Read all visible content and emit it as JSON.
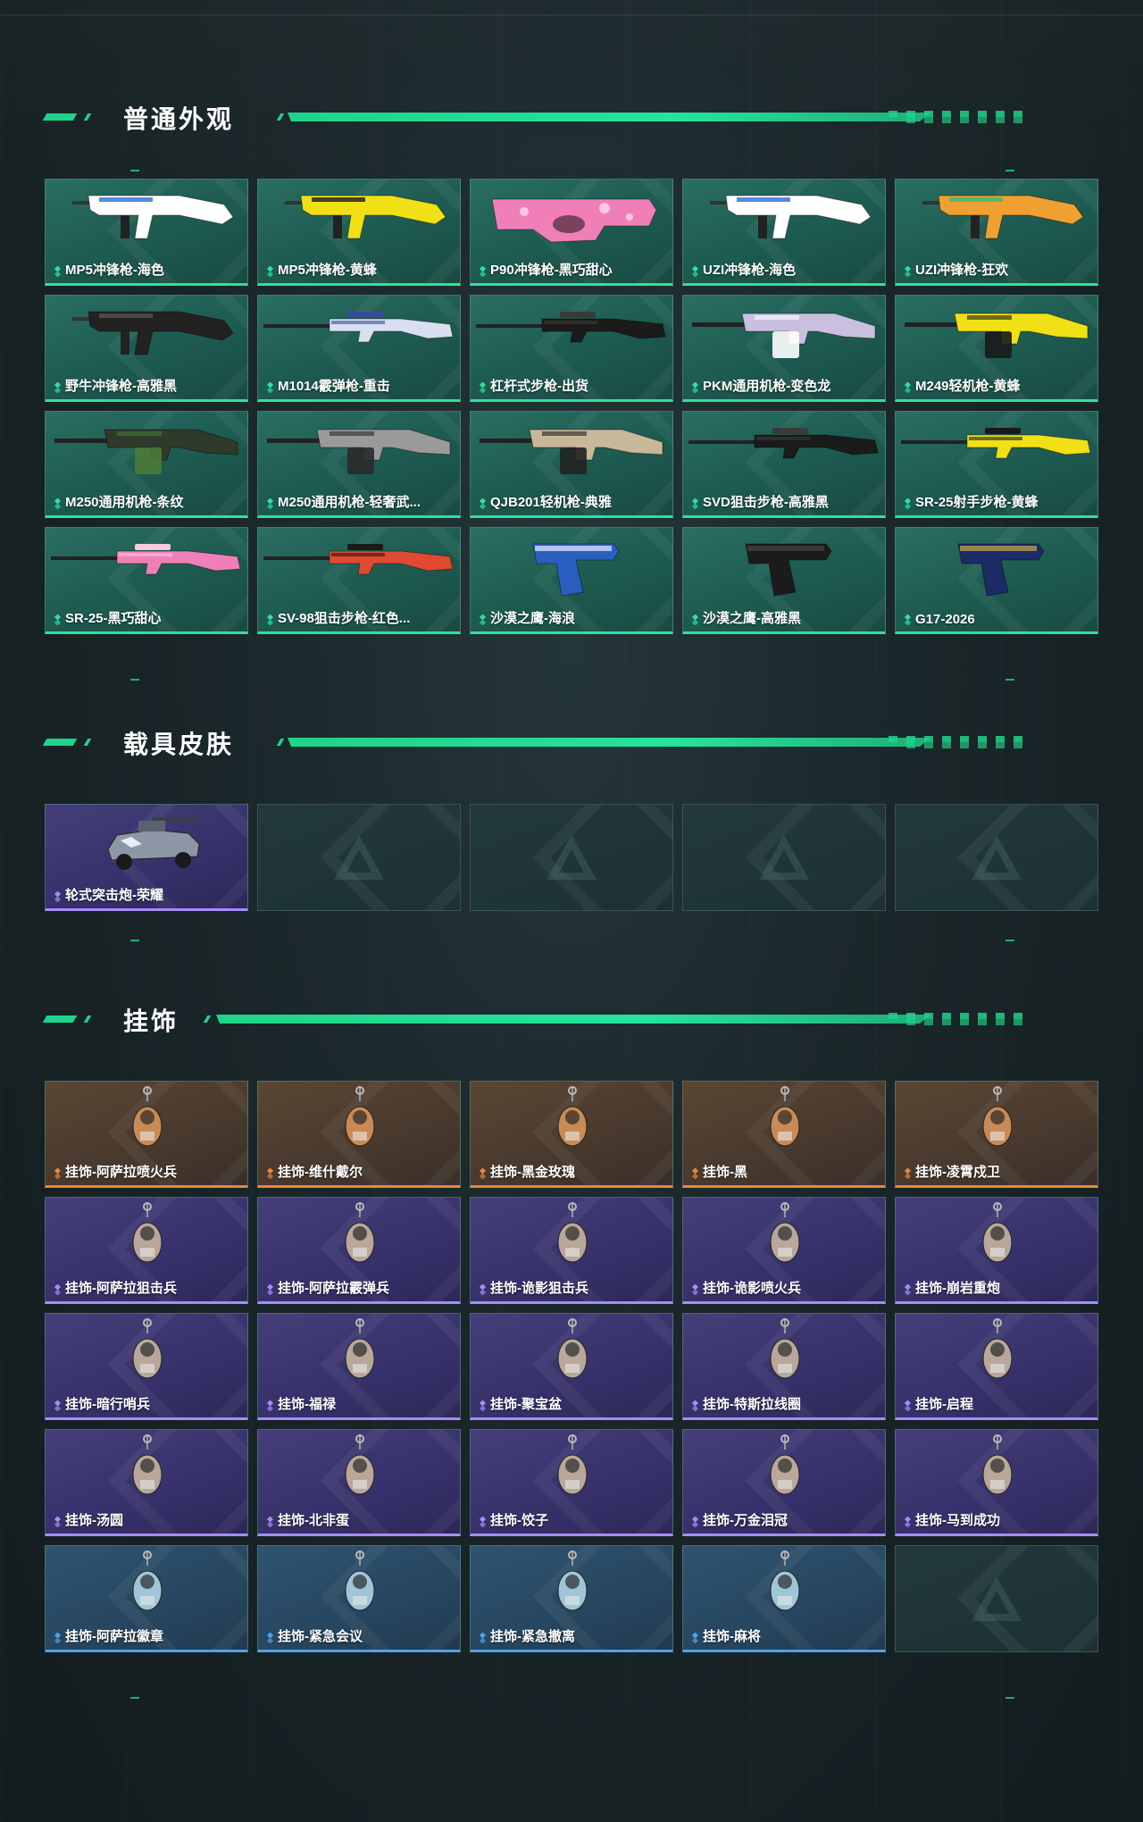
{
  "sections": {
    "weapons": {
      "title": "普通外观",
      "items": [
        {
          "label": "MP5冲锋枪-海色",
          "colors": [
            "#ffffff",
            "#2a6fd8"
          ],
          "icon": "smg-icon"
        },
        {
          "label": "MP5冲锋枪-黄蜂",
          "colors": [
            "#f2e017",
            "#1a1a1a"
          ],
          "icon": "smg-icon"
        },
        {
          "label": "P90冲锋枪-黑巧甜心",
          "colors": [
            "#f07fb8",
            "#f8c9e0"
          ],
          "icon": "p90-icon"
        },
        {
          "label": "UZI冲锋枪-海色",
          "colors": [
            "#ffffff",
            "#2a6fd8"
          ],
          "icon": "uzi-icon"
        },
        {
          "label": "UZI冲锋枪-狂欢",
          "colors": [
            "#f0a030",
            "#2ec07a"
          ],
          "icon": "uzi-icon"
        },
        {
          "label": "野牛冲锋枪-高雅黑",
          "colors": [
            "#222222",
            "#555555"
          ],
          "icon": "smg-icon"
        },
        {
          "label": "M1014霰弹枪-重击",
          "colors": [
            "#d8dff0",
            "#3a4a9a"
          ],
          "icon": "shotgun-icon"
        },
        {
          "label": "杠杆式步枪-出货",
          "colors": [
            "#1b1b1b",
            "#3a3a3a"
          ],
          "icon": "rifle-icon"
        },
        {
          "label": "PKM通用机枪-变色龙",
          "colors": [
            "#c9c0e0",
            "#ffffff"
          ],
          "icon": "mg-icon"
        },
        {
          "label": "M249轻机枪-黄蜂",
          "colors": [
            "#f2e017",
            "#1a1a1a"
          ],
          "icon": "mg-icon"
        },
        {
          "label": "M250通用机枪-条纹",
          "colors": [
            "#2f3a2a",
            "#4a7a3a"
          ],
          "icon": "mg-icon"
        },
        {
          "label": "M250通用机枪-轻奢武...",
          "colors": [
            "#9a9a9a",
            "#2a2a2a"
          ],
          "icon": "mg-icon"
        },
        {
          "label": "QJB201轻机枪-典雅",
          "colors": [
            "#c9b79a",
            "#222222"
          ],
          "icon": "mg-icon"
        },
        {
          "label": "SVD狙击步枪-高雅黑",
          "colors": [
            "#1b1b1b",
            "#3a3a3a"
          ],
          "icon": "sniper-icon"
        },
        {
          "label": "SR-25射手步枪-黄蜂",
          "colors": [
            "#f2e017",
            "#1a1a1a"
          ],
          "icon": "sniper-icon"
        },
        {
          "label": "SR-25-黑巧甜心",
          "colors": [
            "#f07fb8",
            "#f8c9e0"
          ],
          "icon": "rifle-icon"
        },
        {
          "label": "SV-98狙击步枪-红色...",
          "colors": [
            "#e04a30",
            "#1a1a1a"
          ],
          "icon": "sniper-icon"
        },
        {
          "label": "沙漠之鹰-海浪",
          "colors": [
            "#2a5fc0",
            "#e8f0ff"
          ],
          "icon": "pistol-icon"
        },
        {
          "label": "沙漠之鹰-高雅黑",
          "colors": [
            "#1b1b1b",
            "#444444"
          ],
          "icon": "pistol-icon"
        },
        {
          "label": "G17-2026",
          "colors": [
            "#1c2a66",
            "#c9a94a"
          ],
          "icon": "pistol-icon"
        }
      ]
    },
    "vehicles": {
      "title": "载具皮肤",
      "items": [
        {
          "label": "轮式突击炮-荣耀",
          "icon": "vehicle-icon"
        }
      ]
    },
    "charms": {
      "title": "挂饰",
      "items": [
        {
          "label": "挂饰-阿萨拉喷火兵",
          "rarity": "orange"
        },
        {
          "label": "挂饰-维什戴尔",
          "rarity": "orange"
        },
        {
          "label": "挂饰-黑金玫瑰",
          "rarity": "orange"
        },
        {
          "label": "挂饰-黑",
          "rarity": "orange"
        },
        {
          "label": "挂饰-凌霄戍卫",
          "rarity": "orange"
        },
        {
          "label": "挂饰-阿萨拉狙击兵",
          "rarity": "purple"
        },
        {
          "label": "挂饰-阿萨拉霰弹兵",
          "rarity": "purple"
        },
        {
          "label": "挂饰-诡影狙击兵",
          "rarity": "purple"
        },
        {
          "label": "挂饰-诡影喷火兵",
          "rarity": "purple"
        },
        {
          "label": "挂饰-崩岩重炮",
          "rarity": "purple"
        },
        {
          "label": "挂饰-暗行哨兵",
          "rarity": "purple"
        },
        {
          "label": "挂饰-福禄",
          "rarity": "purple"
        },
        {
          "label": "挂饰-聚宝盆",
          "rarity": "purple"
        },
        {
          "label": "挂饰-特斯拉线圈",
          "rarity": "purple"
        },
        {
          "label": "挂饰-启程",
          "rarity": "purple"
        },
        {
          "label": "挂饰-汤圆",
          "rarity": "purple"
        },
        {
          "label": "挂饰-北非蛋",
          "rarity": "purple"
        },
        {
          "label": "挂饰-饺子",
          "rarity": "purple"
        },
        {
          "label": "挂饰-万金泪冠",
          "rarity": "purple"
        },
        {
          "label": "挂饰-马到成功",
          "rarity": "purple"
        },
        {
          "label": "挂饰-阿萨拉徽章",
          "rarity": "blue"
        },
        {
          "label": "挂饰-紧急会议",
          "rarity": "blue"
        },
        {
          "label": "挂饰-紧急撤离",
          "rarity": "blue"
        },
        {
          "label": "挂饰-麻将",
          "rarity": "blue"
        }
      ]
    }
  },
  "rarity_colors": {
    "green": "#2fe19b",
    "purple": "#a78bfa",
    "orange": "#e8873a",
    "blue": "#4da3e8"
  }
}
